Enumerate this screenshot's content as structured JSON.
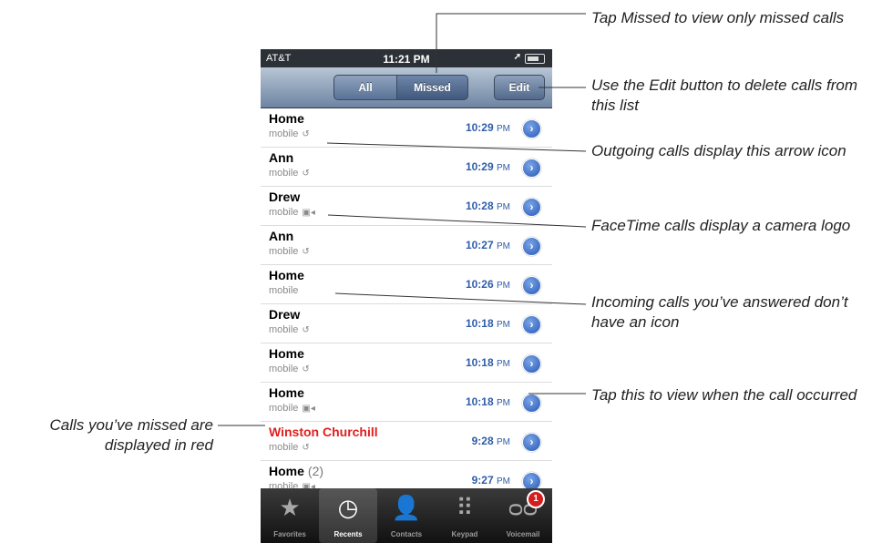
{
  "status_bar": {
    "carrier": "AT&T",
    "time": "11:21 PM"
  },
  "nav": {
    "segment_all": "All",
    "segment_missed": "Missed",
    "edit_label": "Edit"
  },
  "calls": [
    {
      "name": "Home",
      "count": "",
      "type": "mobile",
      "icon": "outgoing-arrow-icon",
      "glyph": "↺",
      "time": "10:29",
      "ampm": "PM",
      "missed": false
    },
    {
      "name": "Ann",
      "count": "",
      "type": "mobile",
      "icon": "outgoing-arrow-icon",
      "glyph": "↺",
      "time": "10:29",
      "ampm": "PM",
      "missed": false
    },
    {
      "name": "Drew",
      "count": "",
      "type": "mobile",
      "icon": "facetime-camera-icon",
      "glyph": "▣◂",
      "time": "10:28",
      "ampm": "PM",
      "missed": false
    },
    {
      "name": "Ann",
      "count": "",
      "type": "mobile",
      "icon": "outgoing-arrow-icon",
      "glyph": "↺",
      "time": "10:27",
      "ampm": "PM",
      "missed": false
    },
    {
      "name": "Home",
      "count": "",
      "type": "mobile",
      "icon": "",
      "glyph": "",
      "time": "10:26",
      "ampm": "PM",
      "missed": false
    },
    {
      "name": "Drew",
      "count": "",
      "type": "mobile",
      "icon": "outgoing-arrow-icon",
      "glyph": "↺",
      "time": "10:18",
      "ampm": "PM",
      "missed": false
    },
    {
      "name": "Home",
      "count": "",
      "type": "mobile",
      "icon": "outgoing-arrow-icon",
      "glyph": "↺",
      "time": "10:18",
      "ampm": "PM",
      "missed": false
    },
    {
      "name": "Home",
      "count": "",
      "type": "mobile",
      "icon": "facetime-camera-icon",
      "glyph": "▣◂",
      "time": "10:18",
      "ampm": "PM",
      "missed": false
    },
    {
      "name": "Winston Churchill",
      "count": "",
      "type": "mobile",
      "icon": "outgoing-arrow-icon",
      "glyph": "↺",
      "time": "9:28",
      "ampm": "PM",
      "missed": true
    },
    {
      "name": "Home",
      "count": "(2)",
      "type": "mobile",
      "icon": "facetime-camera-icon",
      "glyph": "▣◂",
      "time": "9:27",
      "ampm": "PM",
      "missed": false
    },
    {
      "name": "Home",
      "count": "(2)",
      "type": "",
      "icon": "",
      "glyph": "",
      "time": "",
      "ampm": "",
      "missed": false
    }
  ],
  "tabs": [
    {
      "label": "Favorites",
      "icon": "star-icon",
      "glyph": "★",
      "active": false
    },
    {
      "label": "Recents",
      "icon": "clock-icon",
      "glyph": "◷",
      "active": true
    },
    {
      "label": "Contacts",
      "icon": "person-icon",
      "glyph": "👤",
      "active": false
    },
    {
      "label": "Keypad",
      "icon": "keypad-icon",
      "glyph": "⠿",
      "active": false
    },
    {
      "label": "Voicemail",
      "icon": "voicemail-icon",
      "glyph": "ᴑᴑ",
      "active": false,
      "badge": "1"
    }
  ],
  "callouts": {
    "missed_tab": "Tap Missed to view only missed calls",
    "edit": "Use the Edit button to delete calls from this list",
    "outgoing": "Outgoing calls display this arrow icon",
    "facetime": "FaceTime calls display a camera logo",
    "incoming": "Incoming calls you’ve answered don’t have an icon",
    "detail": "Tap this to view when the call occurred",
    "missed_red": "Calls you’ve missed are displayed in red"
  },
  "colors": {
    "missed_text": "#e02020",
    "time_text": "#2f5da8",
    "nav_blue": "#6d84a2"
  }
}
